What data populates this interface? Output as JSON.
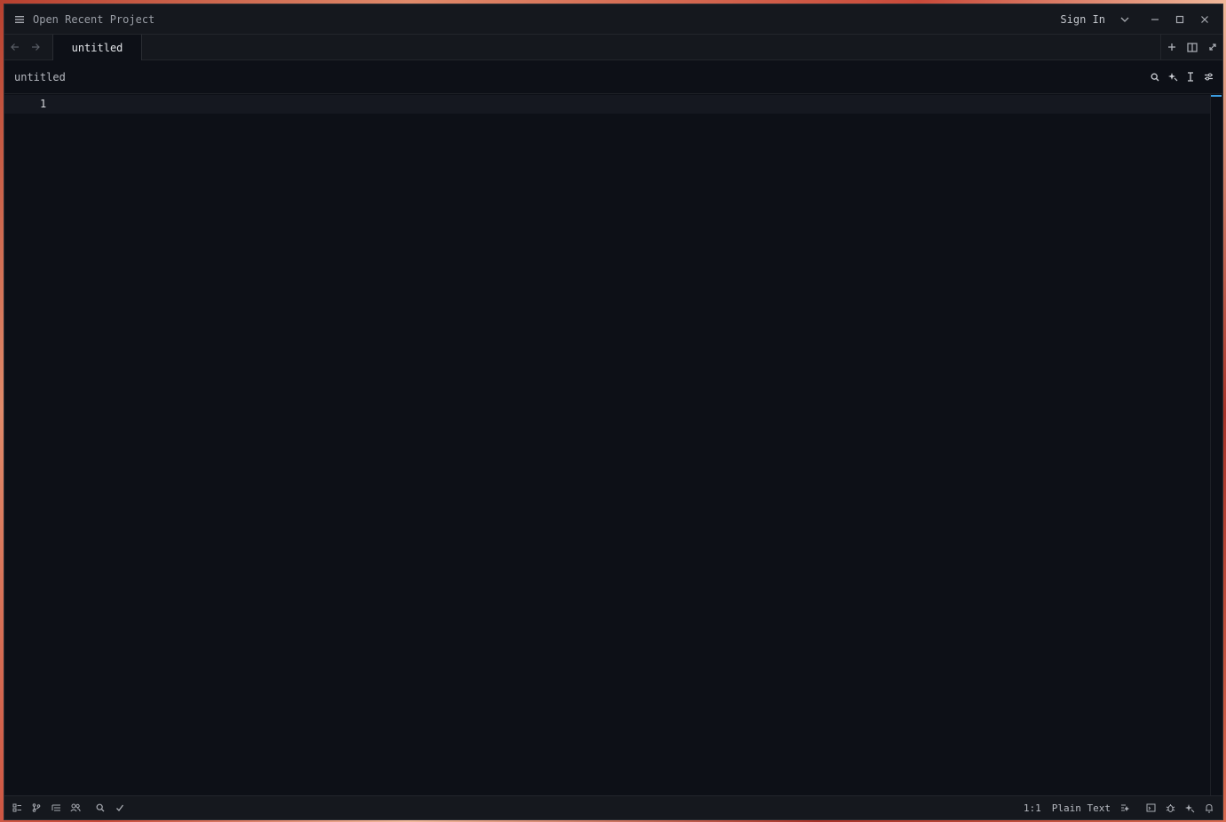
{
  "titlebar": {
    "project_title": "Open Recent Project",
    "signin_label": "Sign In"
  },
  "tabs": [
    {
      "label": "untitled",
      "active": true
    }
  ],
  "breadcrumb": {
    "label": "untitled"
  },
  "editor": {
    "line_numbers": [
      "1"
    ],
    "content": ""
  },
  "statusbar": {
    "cursor_position": "1:1",
    "language": "Plain Text"
  },
  "icons": {
    "menu": "hamburger-icon",
    "chevron": "chevron-down-icon",
    "minimize": "minimize-icon",
    "maximize": "maximize-icon",
    "close": "close-icon",
    "back": "arrow-left-icon",
    "forward": "arrow-right-icon",
    "new_tab": "plus-icon",
    "split": "split-pane-icon",
    "zoom": "expand-icon",
    "search": "search-icon",
    "assist": "sparkle-icon",
    "cursor": "text-cursor-icon",
    "settings": "sliders-icon"
  },
  "colors": {
    "editor_bg": "#0d1017",
    "chrome_bg": "#15181e",
    "accent": "#3b9ce0"
  }
}
